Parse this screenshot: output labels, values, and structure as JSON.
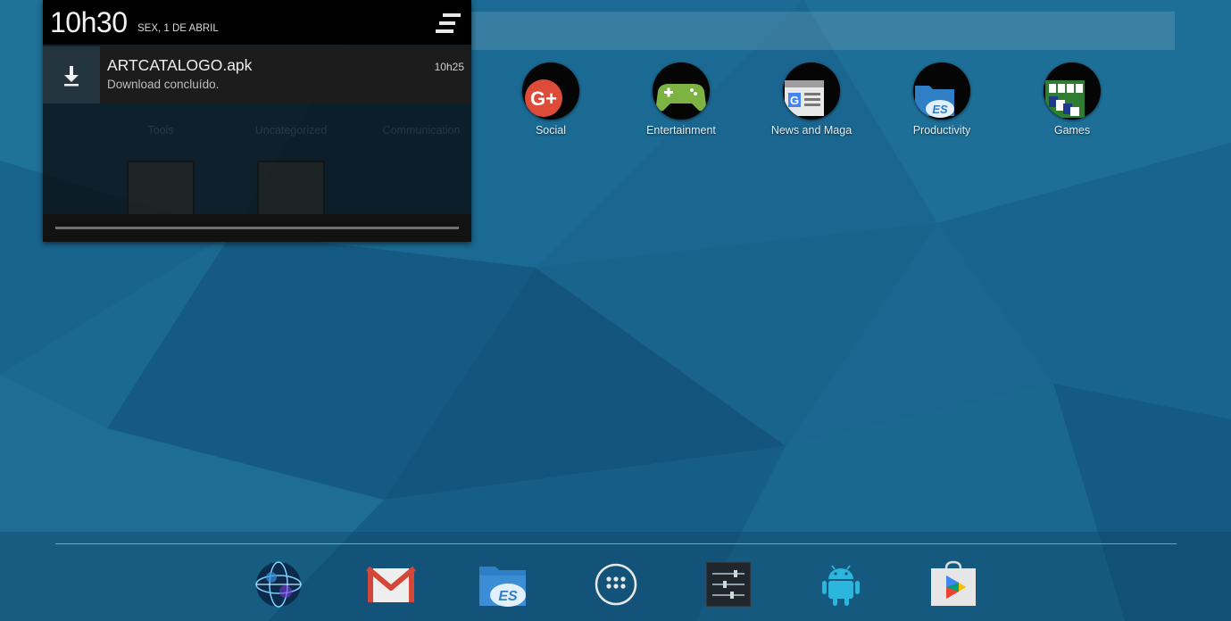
{
  "status": {
    "time": "10h30",
    "date": "SEX, 1 DE ABRIL"
  },
  "notification": {
    "title": "ARTCATALOGO.apk",
    "text": "Download concluído.",
    "time": "10h25",
    "icon": "download-icon"
  },
  "shade_background_labels": [
    "Tools",
    "Uncategorized",
    "Communication"
  ],
  "folders": [
    {
      "label": "Social",
      "icon": "google-plus-icon"
    },
    {
      "label": "Entertainment",
      "icon": "gamepad-icon"
    },
    {
      "label": "News and Maga",
      "icon": "google-news-icon"
    },
    {
      "label": "Productivity",
      "icon": "es-file-explorer-icon"
    },
    {
      "label": "Games",
      "icon": "solitaire-icon"
    }
  ],
  "dock": [
    {
      "icon": "browser-globe-icon"
    },
    {
      "icon": "gmail-icon"
    },
    {
      "icon": "es-file-explorer-icon"
    },
    {
      "icon": "all-apps-icon"
    },
    {
      "icon": "settings-sliders-icon"
    },
    {
      "icon": "android-icon"
    },
    {
      "icon": "play-store-icon"
    }
  ],
  "colors": {
    "wallpaper_base": "#1a5f86",
    "shade_header": "#000000",
    "google_plus": "#dd4b39",
    "gmail_red": "#d44638",
    "android_green": "#2bb6de"
  }
}
